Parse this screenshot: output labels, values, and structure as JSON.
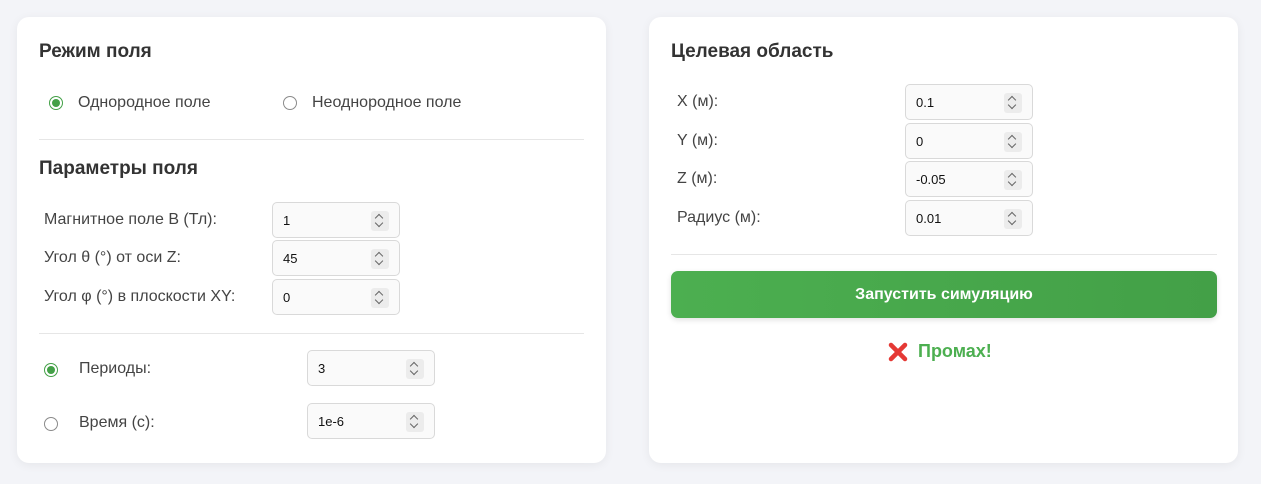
{
  "field_mode": {
    "title": "Режим поля",
    "options": [
      {
        "label": "Однородное поле",
        "checked": true
      },
      {
        "label": "Неоднородное поле",
        "checked": false
      }
    ]
  },
  "field_params": {
    "title": "Параметры поля",
    "rows": [
      {
        "label": "Магнитное поле B (Тл):",
        "value": "1"
      },
      {
        "label": "Угол θ (°) от оси Z:",
        "value": "45"
      },
      {
        "label": "Угол φ (°) в плоскости XY:",
        "value": "0"
      }
    ]
  },
  "duration": {
    "options": [
      {
        "label": "Периоды:",
        "value": "3",
        "checked": true
      },
      {
        "label": "Время (с):",
        "value": "1e-6",
        "checked": false
      }
    ]
  },
  "target": {
    "title": "Целевая область",
    "rows": [
      {
        "label": "X (м):",
        "value": "0.1"
      },
      {
        "label": "Y (м):",
        "value": "0"
      },
      {
        "label": "Z (м):",
        "value": "-0.05"
      },
      {
        "label": "Радиус (м):",
        "value": "0.01"
      }
    ]
  },
  "run_button": {
    "label": "Запустить симуляцию"
  },
  "result": {
    "icon": "cross-icon",
    "text": "Промах!"
  },
  "colors": {
    "accent": "#43a047",
    "error": "#e53935",
    "background": "#f3f4f8"
  }
}
